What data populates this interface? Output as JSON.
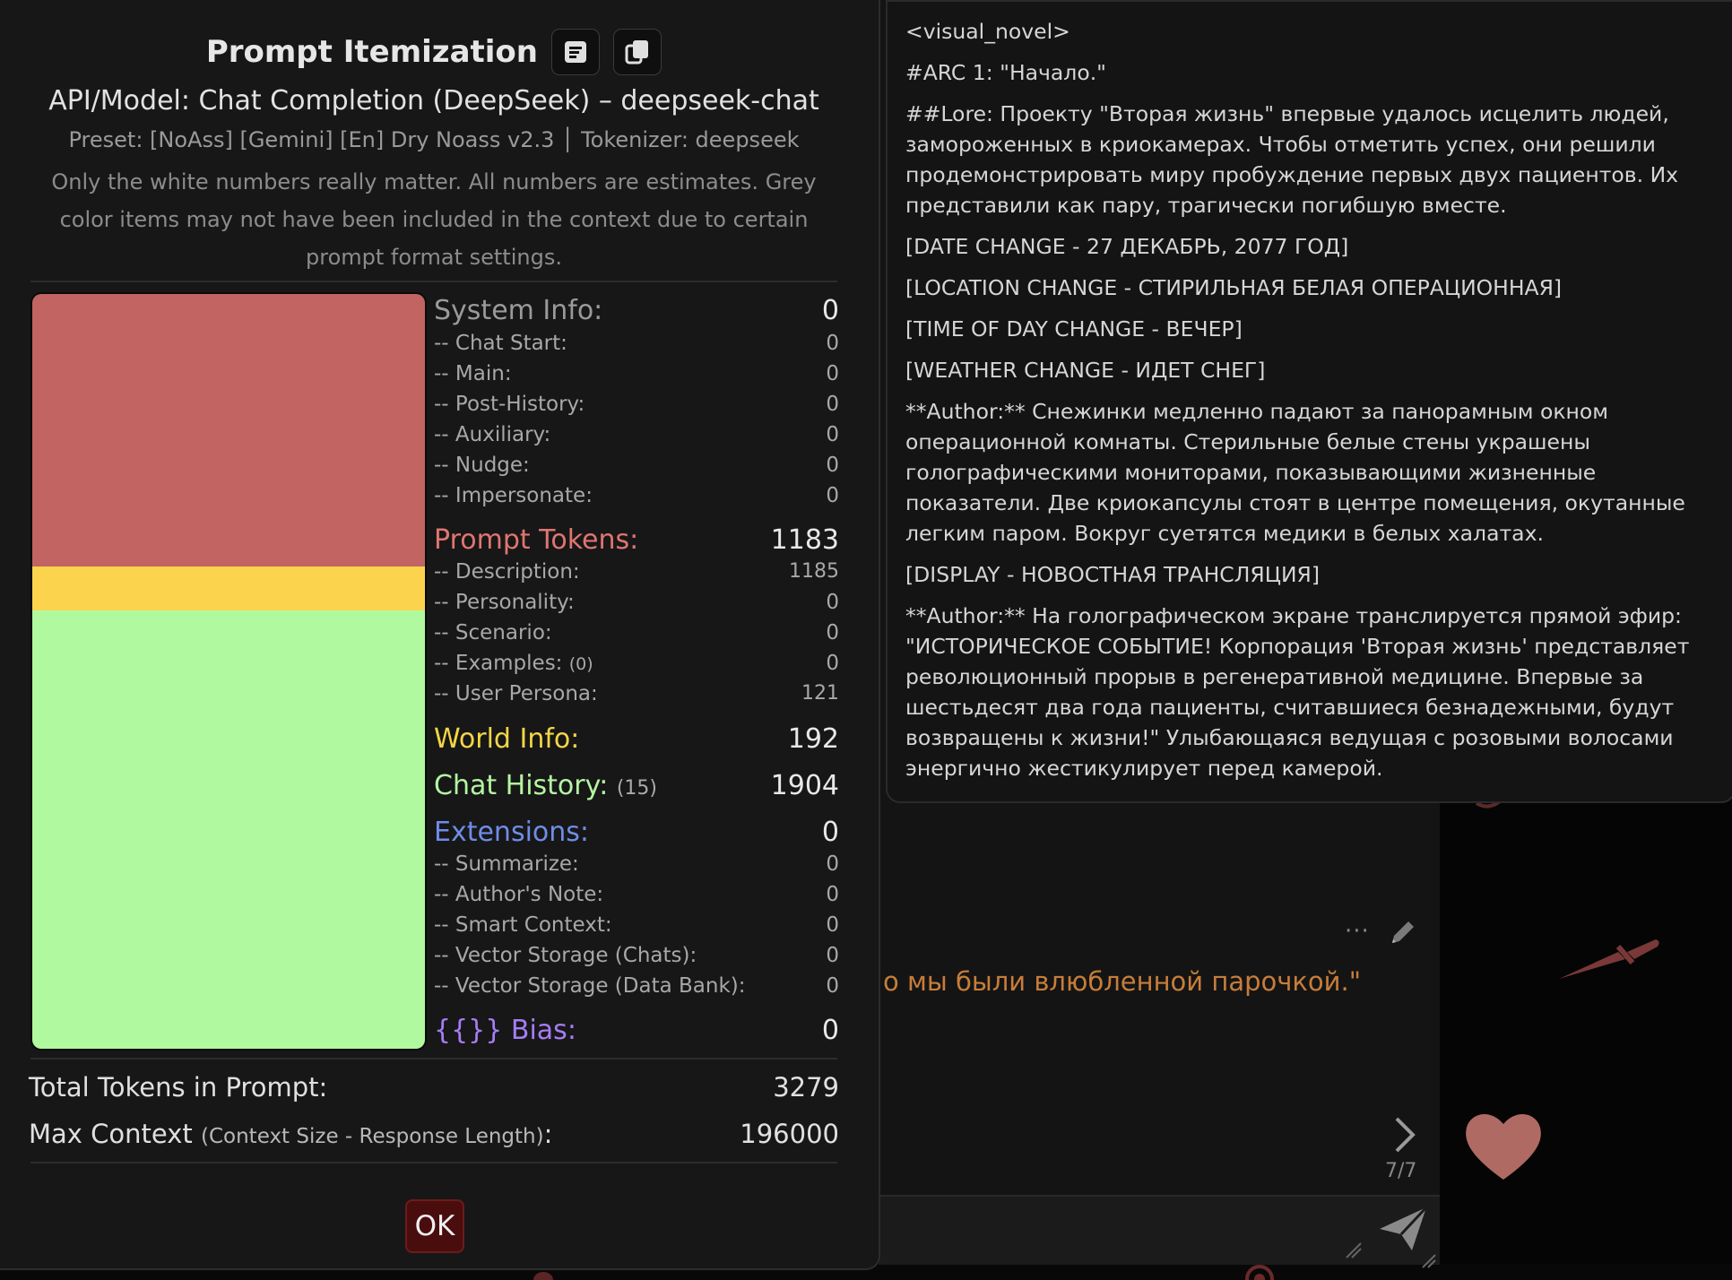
{
  "popup": {
    "title": "Prompt Itemization",
    "model_line": "API/Model: Chat Completion (DeepSeek) – deepseek-chat",
    "preset_line": "Preset: [NoAss] [Gemini] [En] Dry Noass v2.3 │ Tokenizer: deepseek",
    "note": "Only the white numbers really matter. All numbers are estimates. Grey color items may not have been included in the context due to certain prompt format settings.",
    "bar_segments": [
      {
        "name": "Prompt Tokens",
        "value": 1183,
        "color": "#c26461"
      },
      {
        "name": "World Info",
        "value": 192,
        "color": "#fcd34d"
      },
      {
        "name": "Chat History",
        "value": 1904,
        "color": "#b1f99e"
      }
    ],
    "colors": {
      "system": "#9a9a9a",
      "prompt": "#e07572",
      "world": "#f5d547",
      "history": "#b4f5a2",
      "extensions": "#6f8de8",
      "bias": "#a67df5"
    },
    "system_info": {
      "label": "System Info:",
      "value": "0",
      "items": [
        {
          "label": "-- Chat Start:",
          "value": "0"
        },
        {
          "label": "-- Main:",
          "value": "0"
        },
        {
          "label": "-- Post-History:",
          "value": "0"
        },
        {
          "label": "-- Auxiliary:",
          "value": "0"
        },
        {
          "label": "-- Nudge:",
          "value": "0"
        },
        {
          "label": "-- Impersonate:",
          "value": "0"
        }
      ]
    },
    "prompt_tokens": {
      "label": "Prompt Tokens:",
      "value": "1183",
      "items": [
        {
          "label": "-- Description:",
          "value": "1185"
        },
        {
          "label": "-- Personality:",
          "value": "0"
        },
        {
          "label": "-- Scenario:",
          "value": "0"
        },
        {
          "label": "-- Examples:",
          "count": "(0)",
          "value": "0"
        },
        {
          "label": "-- User Persona:",
          "value": "121"
        }
      ]
    },
    "world_info": {
      "label": "World Info:",
      "value": "192"
    },
    "chat_history": {
      "label": "Chat History:",
      "count": "(15)",
      "value": "1904"
    },
    "extensions": {
      "label": "Extensions:",
      "value": "0",
      "items": [
        {
          "label": "-- Summarize:",
          "value": "0"
        },
        {
          "label": "-- Author's Note:",
          "value": "0"
        },
        {
          "label": "-- Smart Context:",
          "value": "0"
        },
        {
          "label": "-- Vector Storage (Chats):",
          "value": "0"
        },
        {
          "label": "-- Vector Storage (Data Bank):",
          "value": "0"
        }
      ]
    },
    "bias": {
      "label": "{{}} Bias:",
      "value": "0"
    },
    "total": {
      "label": "Total Tokens in Prompt:",
      "value": "3279"
    },
    "max_context": {
      "label": "Max Context",
      "paren": "(Context Size - Response Length)",
      "colon": ":",
      "value": "196000"
    },
    "ok_label": "OK"
  },
  "text_panel": {
    "paragraphs": [
      "<visual_novel>",
      "#ARC 1: \"Начало.\"",
      "##Lore: Проекту \"Вторая жизнь\" впервые удалось исцелить людей, замороженных в криокамерах. Чтобы отметить успех, они решили продемонстрировать миру пробуждение первых двух пациентов. Их представили как пару, трагически погибшую вместе.",
      "[DATE CHANGE - 27 ДЕКАБРЬ, 2077 ГОД]",
      "[LOCATION CHANGE - СТИРИЛЬНАЯ БЕЛАЯ ОПЕРАЦИОННАЯ]",
      "[TIME OF DAY CHANGE - ВЕЧЕР]",
      "[WEATHER CHANGE - ИДЕТ СНЕГ]",
      "**Author:** Снежинки медленно падают за панорамным окном операционной комнаты. Стерильные белые стены украшены голографическими мониторами, показывающими жизненные показатели. Две криокапсулы стоят в центре помещения, окутанные легким паром. Вокруг суетятся медики в белых халатах.",
      "[DISPLAY - НОВОСТНАЯ ТРАНСЛЯЦИЯ]",
      "**Author:** На голографическом экране транслируется прямой эфир: \"ИСТОРИЧЕСКОЕ СОБЫТИЕ! Корпорация 'Вторая жизнь' представляет революционный прорыв в регенеративной медицине. Впервые за шестьдесят два года пациенты, считавшиеся безнадежными, будут возвращены к жизни!\" Улыбающаяся ведущая с розовыми волосами энергично жестикулирует перед камерой."
    ]
  },
  "chat": {
    "message_fragment": "о мы были влюбленной парочкой.\"",
    "counter": "7/7",
    "dots": "···"
  }
}
